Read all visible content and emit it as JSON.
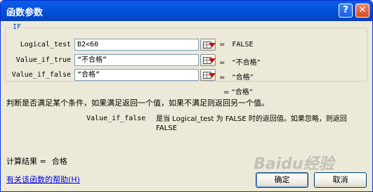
{
  "window": {
    "title": "函数参数",
    "help_button": "?",
    "close_button": "✕"
  },
  "function": {
    "name": "IF",
    "params": [
      {
        "label": "Logical_test",
        "value": "B2<60",
        "result": "FALSE"
      },
      {
        "label": "Value_if_true",
        "value": "“不合格”",
        "result": "“不合格”"
      },
      {
        "label": "Value_if_false",
        "value": "“合格”",
        "result": "“合格”"
      }
    ],
    "overall_result": "= “合格”",
    "description": "判断是否满足某个条件，如果满足返回一个值，如果不满足则返回另一个值。",
    "arg_name": "Value_if_false",
    "arg_description": "是当 Logical_test 为 FALSE 时的返回值。如果忽略，则返回 FALSE"
  },
  "calc": {
    "label": "计算结果 =",
    "value": "合格"
  },
  "help_link": "有关该函数的帮助(H)",
  "buttons": {
    "ok": "确定",
    "cancel": "取消"
  },
  "watermark": "Baidu经验",
  "icons": {
    "ref_button": "collapse-dialog-icon"
  }
}
